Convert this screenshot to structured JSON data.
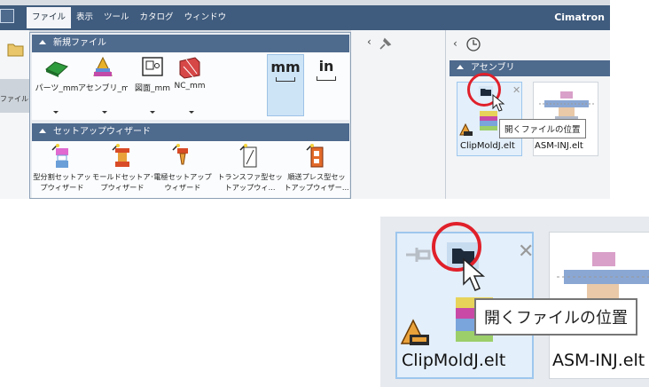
{
  "app": {
    "title": "Cimatron"
  },
  "menu": {
    "items": [
      "ファイル",
      "表示",
      "ツール",
      "カタログ",
      "ウィンドウ"
    ]
  },
  "left_ribbon": {
    "label": "ファイルを"
  },
  "dropdown": {
    "new_file": {
      "header": "新規ファイル",
      "items": [
        {
          "label": "パーツ_mm",
          "icon": "part-file-icon"
        },
        {
          "label": "アセンブリ_mm",
          "icon": "assembly-file-icon"
        },
        {
          "label": "図面_mm",
          "icon": "drawing-file-icon"
        },
        {
          "label": "NC_mm",
          "icon": "nc-file-icon"
        }
      ],
      "units": [
        {
          "label": "mm",
          "selected": true
        },
        {
          "label": "in",
          "selected": false
        }
      ]
    },
    "setup_wizard": {
      "header": "セットアップウィザード",
      "items": [
        {
          "line1": "型分割セットアッ",
          "line2": "プウィザード",
          "icon": "mold-split-wizard-icon"
        },
        {
          "line1": "モールドセットアッ",
          "line2": "プウィザード",
          "icon": "mold-setup-wizard-icon"
        },
        {
          "line1": "電極セットアップ",
          "line2": "ウィザード",
          "icon": "electrode-wizard-icon"
        },
        {
          "line1": "トランスファ型セッ",
          "line2": "トアップウィ...",
          "icon": "transfer-die-wizard-icon"
        },
        {
          "line1": "順送プレス型セッ",
          "line2": "トアップウィザー...",
          "icon": "progressive-die-wizard-icon"
        }
      ]
    }
  },
  "recent_panel": {
    "section_header": "アセンブリ",
    "files": [
      {
        "name": "ClipMoldJ.elt",
        "highlighted": true
      },
      {
        "name": "ASM-INJ.elt",
        "highlighted": false
      }
    ]
  },
  "tooltip": {
    "text": "開くファイルの位置"
  },
  "colors": {
    "titlebar": "#3f5b7d",
    "section_header": "#4e6a8d",
    "highlight": "#e3effa",
    "annotation_ring": "#e0202a"
  }
}
